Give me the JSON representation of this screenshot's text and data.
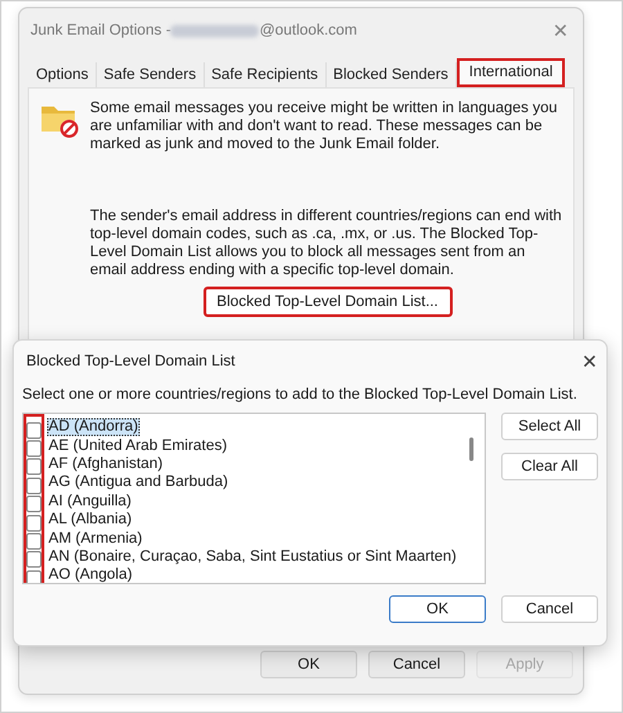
{
  "window": {
    "title_prefix": "Junk Email Options - ",
    "title_suffix": "@outlook.com",
    "close": "✕"
  },
  "tabs": [
    {
      "label": "Options",
      "selected": false,
      "highlighted": false
    },
    {
      "label": "Safe Senders",
      "selected": false,
      "highlighted": false
    },
    {
      "label": "Safe Recipients",
      "selected": false,
      "highlighted": false
    },
    {
      "label": "Blocked Senders",
      "selected": false,
      "highlighted": false
    },
    {
      "label": "International",
      "selected": true,
      "highlighted": true
    }
  ],
  "panel": {
    "intro": "Some email messages you receive might be written in languages you are unfamiliar with and don't want to read. These messages can be marked as junk and moved to the Junk Email folder.",
    "domain_text": "The sender's email address in different countries/regions can end with top-level domain codes, such as .ca, .mx, or .us. The Blocked Top-Level Domain List allows you to block all messages sent from an email address ending with a specific top-level domain.",
    "list_button": {
      "label": "Blocked Top-Level Domain List...",
      "highlighted": true
    }
  },
  "buttons": [
    {
      "label": "OK",
      "disabled": false
    },
    {
      "label": "Cancel",
      "disabled": false
    },
    {
      "label": "Apply",
      "disabled": true
    }
  ],
  "dialog": {
    "title": "Blocked Top-Level Domain List",
    "close": "✕",
    "instruction": "Select one or more countries/regions to add to the Blocked Top-Level Domain List.",
    "checkboxes_highlighted": true,
    "items": [
      {
        "label": "AD (Andorra)",
        "checked": false,
        "selected": true
      },
      {
        "label": "AE (United Arab Emirates)",
        "checked": false,
        "selected": false
      },
      {
        "label": "AF (Afghanistan)",
        "checked": false,
        "selected": false
      },
      {
        "label": "AG (Antigua and Barbuda)",
        "checked": false,
        "selected": false
      },
      {
        "label": "AI (Anguilla)",
        "checked": false,
        "selected": false
      },
      {
        "label": "AL (Albania)",
        "checked": false,
        "selected": false
      },
      {
        "label": "AM (Armenia)",
        "checked": false,
        "selected": false
      },
      {
        "label": "AN (Bonaire, Curaçao, Saba, Sint Eustatius or Sint Maarten)",
        "checked": false,
        "selected": false
      },
      {
        "label": "AO (Angola)",
        "checked": false,
        "selected": false
      }
    ],
    "side_buttons": [
      "Select All",
      "Clear All"
    ],
    "buttons": [
      {
        "label": "OK",
        "default": true
      },
      {
        "label": "Cancel",
        "default": false
      }
    ]
  }
}
